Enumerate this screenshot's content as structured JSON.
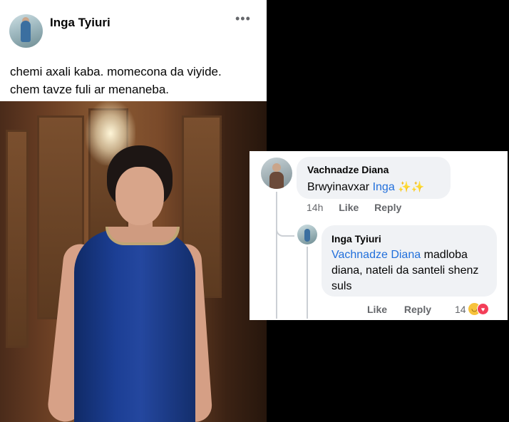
{
  "post": {
    "author": "Inga Tyiuri",
    "more_icon": "•••",
    "text_line1": "chemi axali kaba. momecona da viyide.",
    "text_line2": "chem tavze fuli ar menaneba."
  },
  "comments": [
    {
      "author": "Vachnadze Diana",
      "text": "Brwyinavxar ",
      "mention": "Inga",
      "emoji": "✨✨",
      "time": "14h",
      "like": "Like",
      "reply": "Reply"
    },
    {
      "author": "Inga Tyiuri",
      "mention": "Vachnadze Diana",
      "text": " madloba diana, nateli da santeli shenz suls",
      "like": "Like",
      "reply": "Reply",
      "reaction_count": "14"
    }
  ],
  "colors": {
    "mention": "#216fdb",
    "bubble": "#f0f2f5",
    "meta": "#65676b"
  }
}
